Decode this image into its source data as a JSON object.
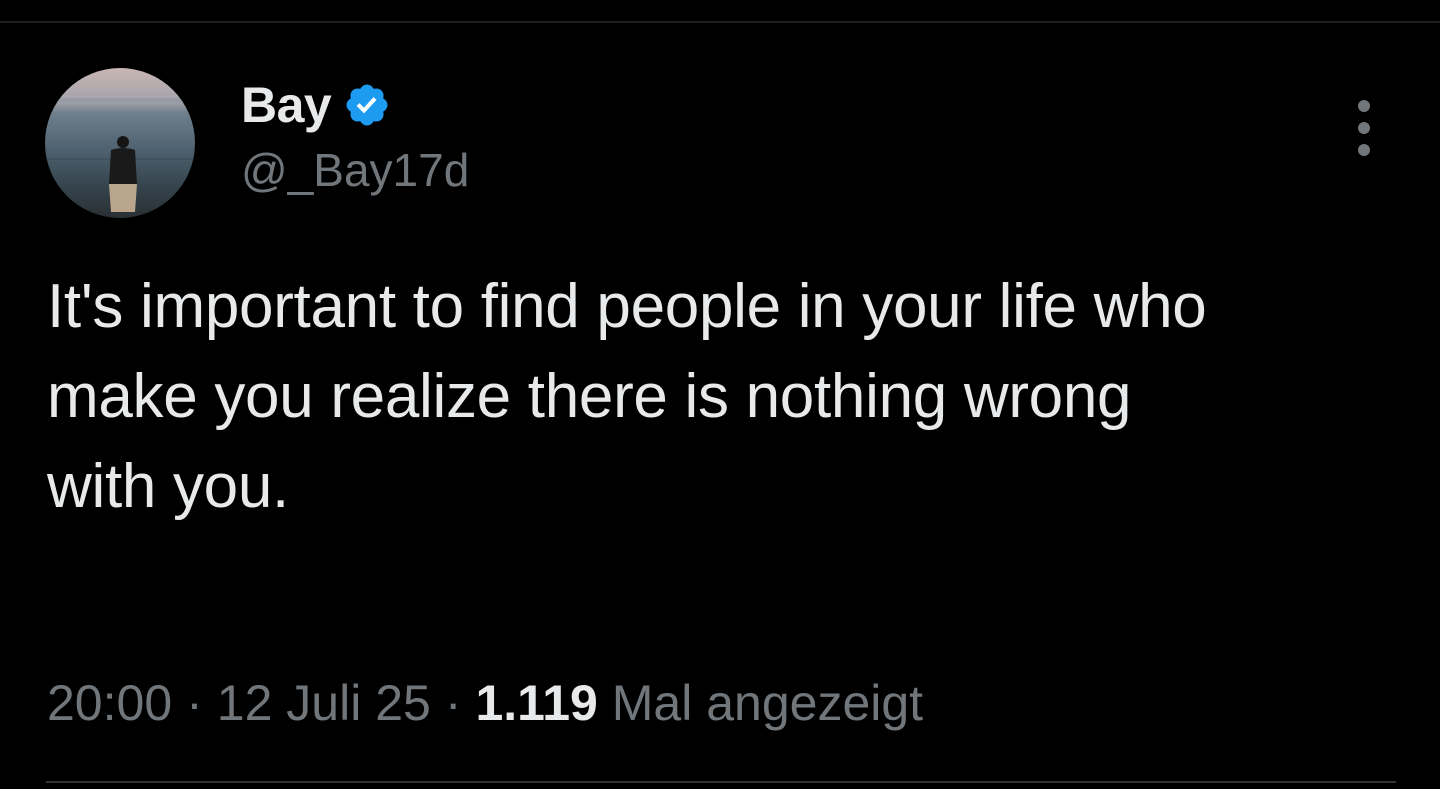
{
  "author": {
    "display_name": "Bay",
    "handle": "@_Bay17d",
    "verified": true,
    "verified_icon": "verified-badge-icon",
    "accent_color": "#1d9bf0"
  },
  "tweet": {
    "lines": [
      "It's important to find people in your life who",
      "make you realize there is nothing wrong",
      "with you."
    ]
  },
  "meta": {
    "time": "20:00",
    "separator": "·",
    "date": "12 Juli 25",
    "views_count": "1.119",
    "views_label": "Mal angezeigt"
  },
  "actions": {
    "more_icon": "more-vertical-icon"
  }
}
